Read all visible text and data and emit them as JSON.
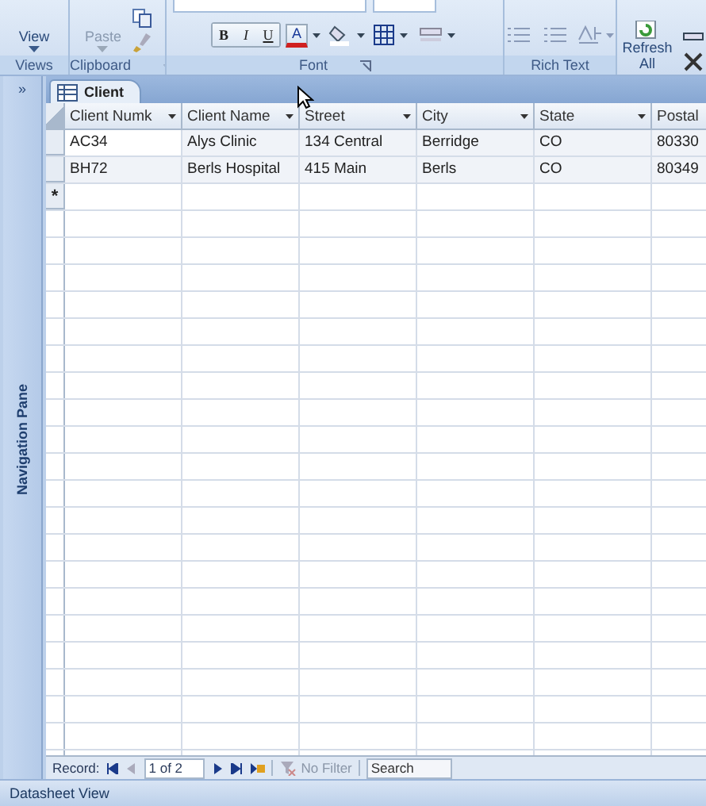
{
  "ribbon": {
    "groups": [
      {
        "kind": "views",
        "label": "Views",
        "buttons": [
          "View"
        ]
      },
      {
        "kind": "clipboard",
        "label": "Clipboard",
        "buttons": [
          "Paste"
        ]
      },
      {
        "kind": "font",
        "label": "Font",
        "buttons": [
          "B",
          "I",
          "U",
          "A"
        ]
      },
      {
        "kind": "richtext",
        "label": "Rich Text"
      },
      {
        "kind": "records",
        "buttons": [
          "Refresh",
          "All"
        ]
      }
    ]
  },
  "navigation_pane": {
    "toggle": "»",
    "label": "Navigation Pane"
  },
  "document_tab": {
    "label": "Client",
    "selected": true
  },
  "table": {
    "columns": [
      "Client Numk",
      "Client Name",
      "Street",
      "City",
      "State",
      "Postal"
    ],
    "rows": [
      {
        "cells": [
          "AC34",
          "Alys Clinic",
          "134 Central",
          "Berridge",
          "CO",
          "80330"
        ],
        "selected": false
      },
      {
        "cells": [
          "BH72",
          "Berls Hospital",
          "415 Main",
          "Berls",
          "CO",
          "80349"
        ],
        "selected": false
      }
    ],
    "new_row_marker": "*"
  },
  "record_navigator": {
    "label": "Record:",
    "position": "1 of 2",
    "filter": "No Filter",
    "search": "Search"
  },
  "status_bar": {
    "text": "Datasheet View"
  }
}
